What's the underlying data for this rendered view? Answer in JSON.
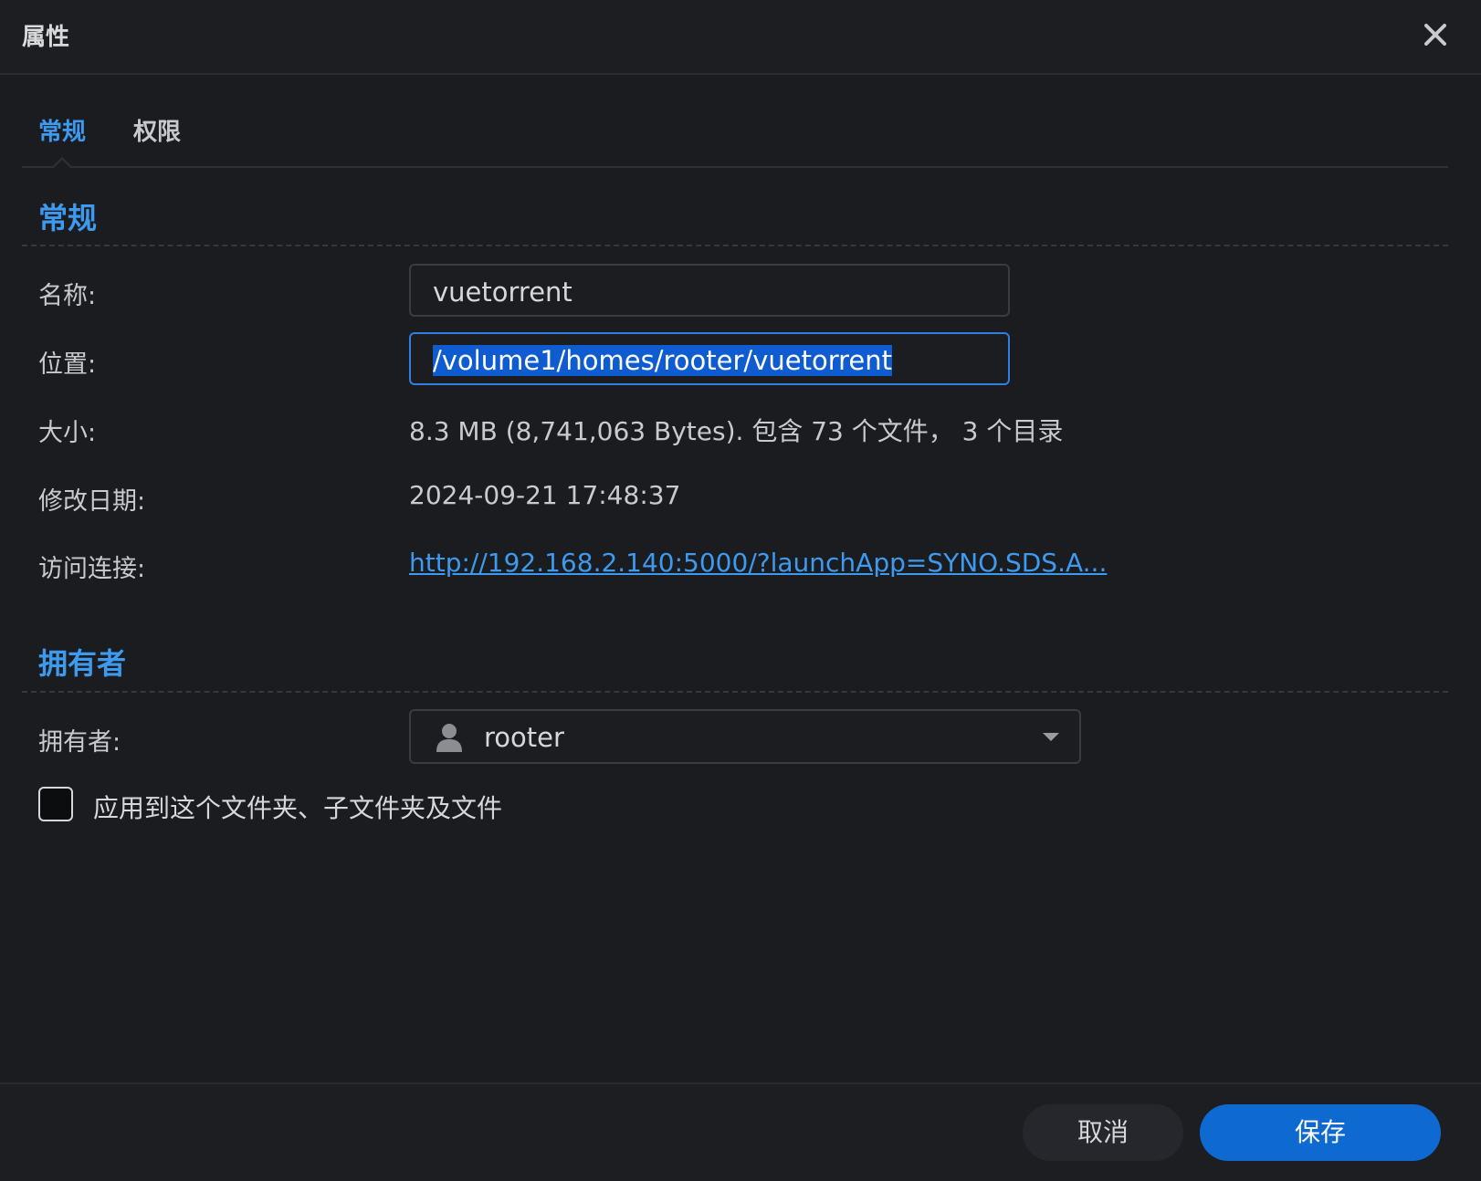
{
  "window": {
    "title": "属性",
    "close_icon": "close-icon"
  },
  "tabs": [
    {
      "label": "常规",
      "active": true
    },
    {
      "label": "权限",
      "active": false
    }
  ],
  "general": {
    "section_title": "常规",
    "name_label": "名称:",
    "name_value": "vuetorrent",
    "location_label": "位置:",
    "location_value": "/volume1/homes/rooter/vuetorrent",
    "size_label": "大小:",
    "size_value": "8.3 MB (8,741,063 Bytes). 包含 73 个文件， 3 个目录",
    "modified_label": "修改日期:",
    "modified_value": "2024-09-21 17:48:37",
    "link_label": "访问连接:",
    "link_value": "http://192.168.2.140:5000/?launchApp=SYNO.SDS.A..."
  },
  "owner": {
    "section_title": "拥有者",
    "owner_label": "拥有者:",
    "owner_value": "rooter",
    "owner_icon": "user-icon",
    "apply_checkbox_label": "应用到这个文件夹、子文件夹及文件",
    "apply_checked": false
  },
  "footer": {
    "cancel_label": "取消",
    "save_label": "保存"
  },
  "colors": {
    "accent": "#3d9aef",
    "primary_button": "#0e6ad0",
    "background": "#1b1c20"
  }
}
